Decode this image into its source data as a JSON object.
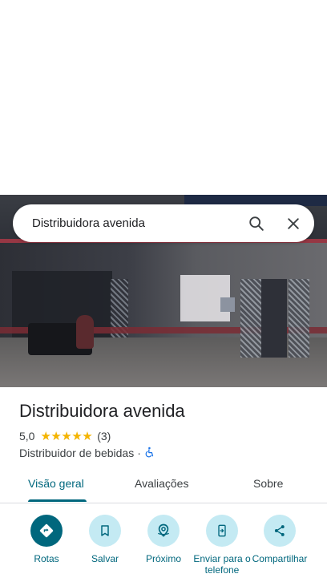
{
  "search": {
    "query": "Distribuidora avenida",
    "search_icon": "search-icon",
    "close_icon": "close-icon"
  },
  "place": {
    "name": "Distribuidora avenida",
    "rating": "5,0",
    "stars": 5,
    "review_count": "(3)",
    "category": "Distribuidor de bebidas",
    "separator": "·",
    "accessibility_icon": "wheelchair-icon"
  },
  "tabs": [
    {
      "label": "Visão geral",
      "active": true
    },
    {
      "label": "Avaliações",
      "active": false
    },
    {
      "label": "Sobre",
      "active": false
    }
  ],
  "actions": [
    {
      "label": "Rotas",
      "icon": "directions-icon"
    },
    {
      "label": "Salvar",
      "icon": "bookmark-icon"
    },
    {
      "label": "Próximo",
      "icon": "nearby-icon"
    },
    {
      "label": "Enviar para o telefone",
      "icon": "send-to-phone-icon"
    },
    {
      "label": "Compartilhar",
      "icon": "share-icon"
    }
  ],
  "colors": {
    "accent": "#00677d",
    "action_bg": "#c4eaf3",
    "star": "#f4b400"
  }
}
